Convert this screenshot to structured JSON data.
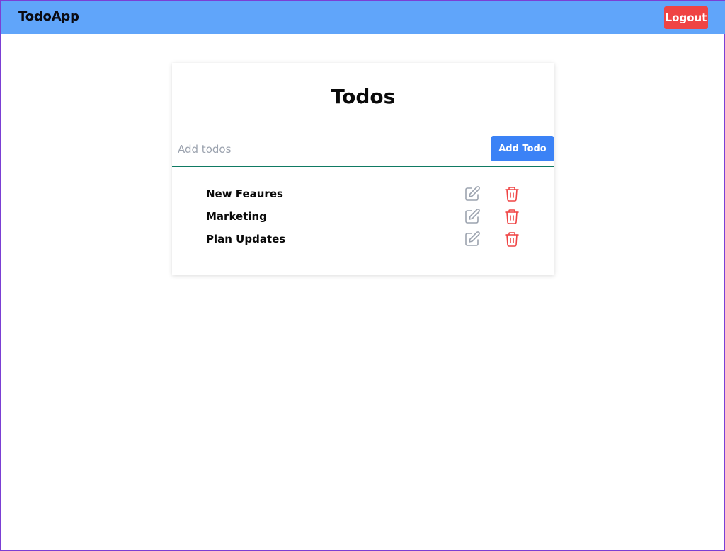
{
  "navbar": {
    "brand": "TodoApp",
    "logout_label": "Logout",
    "background": "#60a5fa",
    "logout_color": "#ef4444"
  },
  "todos_card": {
    "title": "Todos",
    "input": {
      "value": "",
      "placeholder": "Add todos"
    },
    "add_button_label": "Add Todo",
    "add_button_color": "#3b82f6",
    "items": [
      {
        "label": "New Feaures",
        "edit_icon": "edit-icon",
        "delete_icon": "trash-icon"
      },
      {
        "label": "Marketing",
        "edit_icon": "edit-icon",
        "delete_icon": "trash-icon"
      },
      {
        "label": "Plan Updates",
        "edit_icon": "edit-icon",
        "delete_icon": "trash-icon"
      }
    ],
    "edit_icon_color": "#9ca3af",
    "delete_icon_color": "#ef4444"
  }
}
